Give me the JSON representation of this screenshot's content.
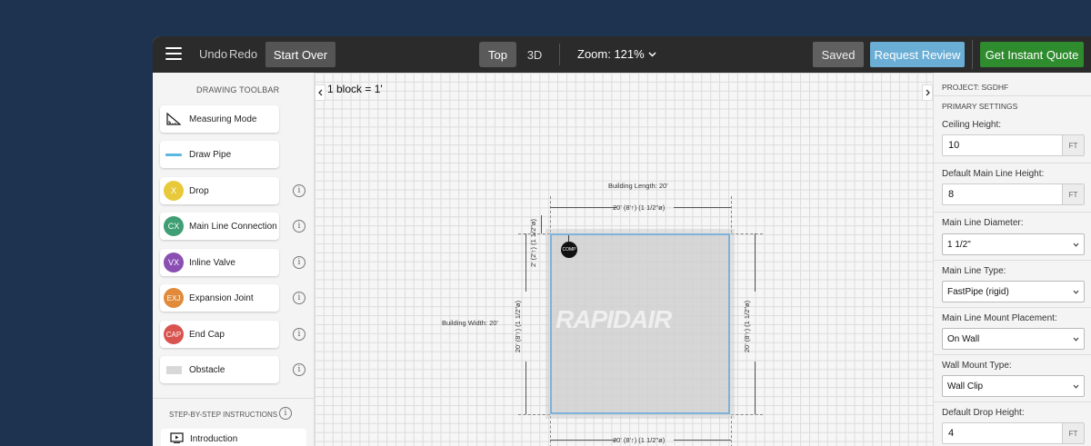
{
  "topbar": {
    "undo": "Undo",
    "redo": "Redo",
    "start_over": "Start Over",
    "view_top": "Top",
    "view_3d": "3D",
    "zoom": "Zoom: 121%",
    "saved": "Saved",
    "request_review": "Request Review",
    "instant_quote": "Get Instant Quote"
  },
  "toolbar": {
    "title": "DRAWING TOOLBAR",
    "tools": [
      {
        "label": "Measuring Mode",
        "badge": "",
        "icon": "ruler-icon"
      },
      {
        "label": "Draw Pipe",
        "badge": "",
        "icon": "pipe-line-icon"
      },
      {
        "label": "Drop",
        "badge": "X",
        "color": "#e8c93a"
      },
      {
        "label": "Main Line Connection",
        "badge": "CX",
        "color": "#3f9e73"
      },
      {
        "label": "Inline Valve",
        "badge": "VX",
        "color": "#8b4fb3"
      },
      {
        "label": "Expansion Joint",
        "badge": "EXJ",
        "color": "#e08a3a"
      },
      {
        "label": "End Cap",
        "badge": "CAP",
        "color": "#d9534f"
      },
      {
        "label": "Obstacle",
        "badge": "",
        "icon": "obstacle-icon"
      }
    ],
    "info_glyph": "i",
    "steps_title": "STEP-BY-STEP INSTRUCTIONS",
    "intro": "Introduction"
  },
  "canvas": {
    "scale": "1 block = 1'",
    "building_length": "Building Length: 20'",
    "building_width": "Building Width: 20'",
    "dim_top": "20' (8'↑) (1 1/2\"ø)",
    "dim_bottom": "20' (8'↑) (1 1/2\"ø)",
    "dim_left": "20' (8'↑) (1 1/2\"ø)",
    "dim_right": "20' (8'↑) (1 1/2\"ø)",
    "dim_drop": "2' (2'↑) (1 1/2\"ø)",
    "comp": "COMP",
    "watermark": "RAPIDAIR"
  },
  "settings": {
    "project": "PROJECT: SGDHF",
    "primary": "PRIMARY SETTINGS",
    "ceiling_label": "Ceiling Height:",
    "ceiling_value": "10",
    "unit": "FT",
    "main_line_height_label": "Default Main Line Height:",
    "main_line_height_value": "8",
    "diameter_label": "Main Line Diameter:",
    "diameter_value": "1 1/2\"",
    "type_label": "Main Line Type:",
    "type_value": "FastPipe (rigid)",
    "mount_label": "Main Line Mount Placement:",
    "mount_value": "On Wall",
    "wall_mount_label": "Wall Mount Type:",
    "wall_mount_value": "Wall Clip",
    "drop_height_label": "Default Drop Height:",
    "drop_height_value": "4"
  }
}
